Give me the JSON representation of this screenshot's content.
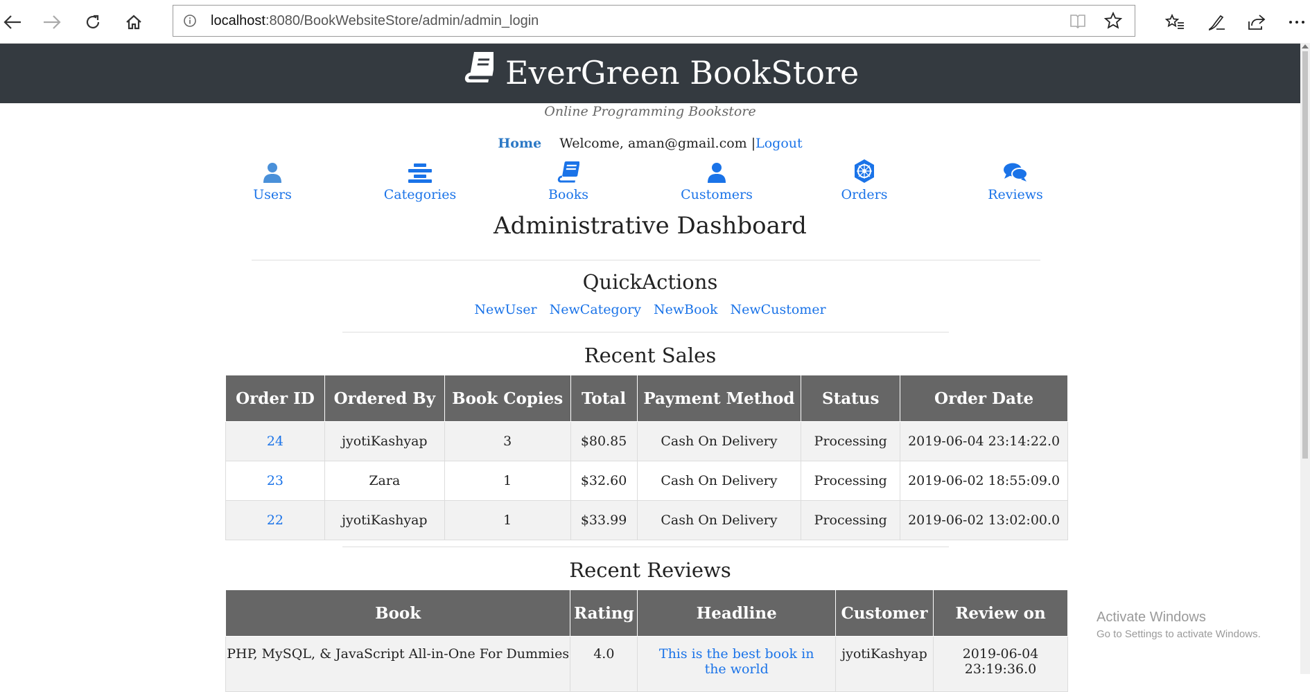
{
  "browser": {
    "url_host": "localhost",
    "url_rest": ":8080/BookWebsiteStore/admin/admin_login"
  },
  "header": {
    "brand": "EverGreen BookStore",
    "tagline": "Online Programming Bookstore",
    "home_link": "Home",
    "welcome_text": "Welcome, aman@gmail.com |",
    "logout_link": "Logout",
    "background_color": "#343a40"
  },
  "menu": [
    {
      "label": "Users",
      "icon": "user-icon"
    },
    {
      "label": "Categories",
      "icon": "stack-icon"
    },
    {
      "label": "Books",
      "icon": "book-icon"
    },
    {
      "label": "Customers",
      "icon": "customer-icon"
    },
    {
      "label": "Orders",
      "icon": "orders-icon"
    },
    {
      "label": "Reviews",
      "icon": "comments-icon"
    }
  ],
  "dashboard": {
    "title": "Administrative Dashboard",
    "quick_actions_title": "QuickActions",
    "quick_actions": [
      "NewUser",
      "NewCategory",
      "NewBook",
      "NewCustomer"
    ]
  },
  "recent_sales": {
    "title": "Recent Sales",
    "columns": [
      "Order ID",
      "Ordered By",
      "Book Copies",
      "Total",
      "Payment Method",
      "Status",
      "Order Date"
    ],
    "rows": [
      [
        "24",
        "jyotiKashyap",
        "3",
        "$80.85",
        "Cash On Delivery",
        "Processing",
        "2019-06-04 23:14:22.0"
      ],
      [
        "23",
        "Zara",
        "1",
        "$32.60",
        "Cash On Delivery",
        "Processing",
        "2019-06-02 18:55:09.0"
      ],
      [
        "22",
        "jyotiKashyap",
        "1",
        "$33.99",
        "Cash On Delivery",
        "Processing",
        "2019-06-02 13:02:00.0"
      ]
    ]
  },
  "recent_reviews": {
    "title": "Recent Reviews",
    "columns": [
      "Book",
      "Rating",
      "Headline",
      "Customer",
      "Review on"
    ],
    "rows": [
      [
        "PHP, MySQL, & JavaScript All-in-One For Dummies",
        "4.0",
        "This is the best book in the world",
        "jyotiKashyap",
        "2019-06-04 23:19:36.0"
      ]
    ]
  },
  "watermark": {
    "line1": "Activate Windows",
    "line2": "Go to Settings to activate Windows."
  },
  "colors": {
    "link": "#1a73e8",
    "table_header": "#666666"
  }
}
